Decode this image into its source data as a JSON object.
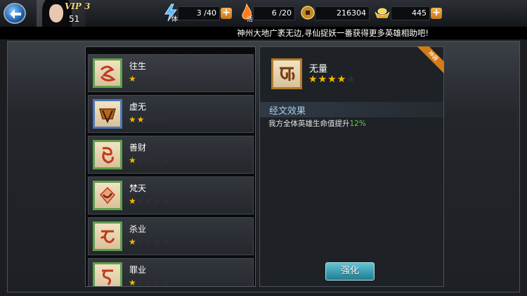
{
  "header": {
    "vip_label": "VIP 3",
    "level": "51",
    "stamina": {
      "icon": "lightning-icon",
      "sub_label": "体",
      "value": "3 /40"
    },
    "energy": {
      "icon": "flame-icon",
      "sub_label": "活",
      "value": "6 /20"
    },
    "coins": {
      "icon": "coin-icon",
      "value": "216304"
    },
    "ingots": {
      "icon": "gold-ingot-icon",
      "value": "445"
    },
    "plus_label": "+"
  },
  "marquee": {
    "text": "神州大地广袤无边,寻仙捉妖一番获得更多英雄相助吧!"
  },
  "scripture_list": [
    {
      "name": "往生",
      "stars": 1,
      "max_stars": 5,
      "frame": "green"
    },
    {
      "name": "虚无",
      "stars": 2,
      "max_stars": 5,
      "frame": "blue"
    },
    {
      "name": "善财",
      "stars": 1,
      "max_stars": 5,
      "frame": "green"
    },
    {
      "name": "梵天",
      "stars": 1,
      "max_stars": 5,
      "frame": "green"
    },
    {
      "name": "杀业",
      "stars": 1,
      "max_stars": 5,
      "frame": "green"
    },
    {
      "name": "罪业",
      "stars": 1,
      "max_stars": 5,
      "frame": "green"
    }
  ],
  "detail": {
    "name": "无量",
    "stars": 4,
    "max_stars": 5,
    "ribbon": "神器",
    "effect_title": "经文效果",
    "effect_desc": "我方全体英雄生命值提升",
    "effect_value": "12%",
    "upgrade_label": "强化"
  },
  "colors": {
    "star_on": "#f5b800",
    "effect_value": "#5fd13a",
    "accent_button": "#2a9db0"
  }
}
